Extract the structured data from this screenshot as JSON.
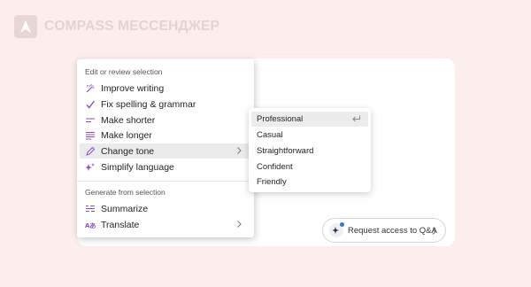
{
  "brand": {
    "name": "COMPASS МЕССЕНДЖЕР",
    "logo_icon": "compass-arrow-icon"
  },
  "colors": {
    "background": "#fbeeed",
    "accent": "#8a4fc9",
    "menu_text": "#242424"
  },
  "menu": {
    "sections": [
      {
        "label": "Edit or review selection",
        "items": [
          {
            "label": "Improve writing",
            "icon": "sparkle-wand-icon"
          },
          {
            "label": "Fix spelling & grammar",
            "icon": "checkmark-icon"
          },
          {
            "label": "Make shorter",
            "icon": "short-lines-icon"
          },
          {
            "label": "Make longer",
            "icon": "long-lines-icon"
          },
          {
            "label": "Change tone",
            "icon": "pen-icon",
            "has_submenu": true,
            "active": true
          },
          {
            "label": "Simplify language",
            "icon": "sparkles-icon"
          }
        ]
      },
      {
        "label": "Generate from selection",
        "items": [
          {
            "label": "Summarize",
            "icon": "summary-lines-icon"
          },
          {
            "label": "Translate",
            "icon": "translate-icon",
            "has_submenu": true
          }
        ]
      }
    ]
  },
  "submenu": {
    "items": [
      {
        "label": "Professional",
        "active": true,
        "icon": "enter-key-icon"
      },
      {
        "label": "Casual"
      },
      {
        "label": "Straightforward"
      },
      {
        "label": "Confident"
      },
      {
        "label": "Friendly"
      }
    ]
  },
  "request_access": {
    "label": "Request access to Q&A",
    "icon": "ai-sparkle-avatar-icon"
  }
}
